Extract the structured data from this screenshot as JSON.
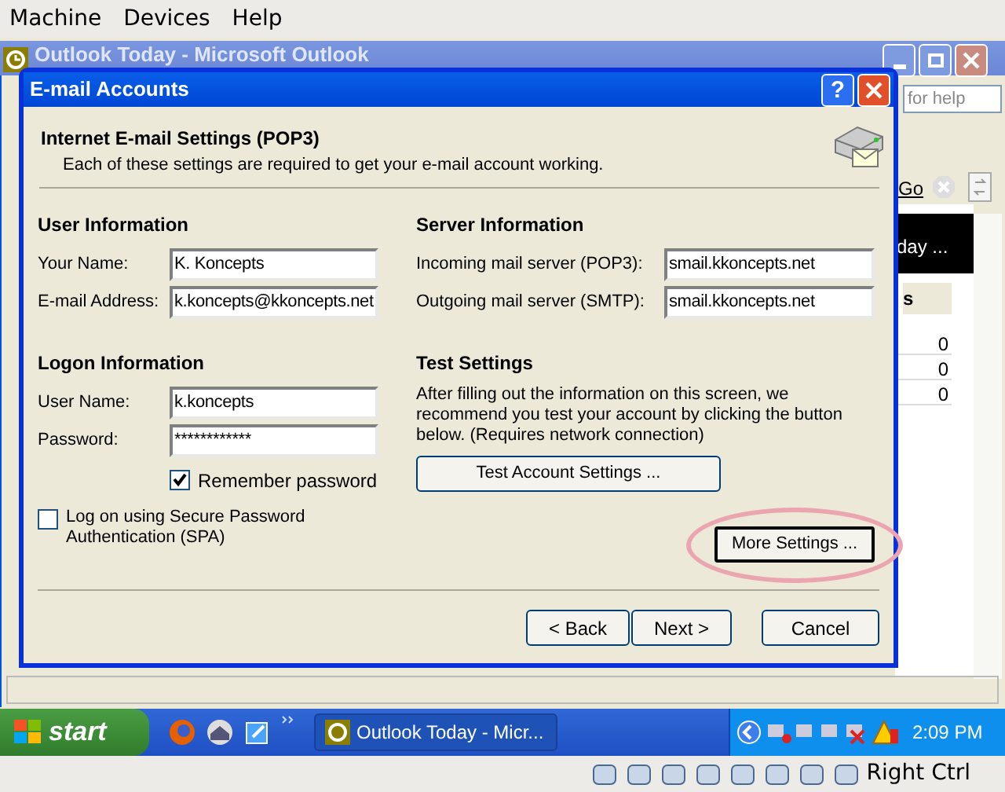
{
  "vbox_menu": [
    {
      "label": "Machine"
    },
    {
      "label": "Devices"
    },
    {
      "label": "Help"
    }
  ],
  "outlook": {
    "title": "Outlook Today - Microsoft Outlook",
    "help_box": "for help",
    "go": "Go",
    "panel_heading": "day ...",
    "column_header": "s",
    "counts": [
      "0",
      "0",
      "0"
    ]
  },
  "dialog": {
    "title": "E-mail Accounts",
    "help_glyph": "?",
    "heading": "Internet E-mail Settings (POP3)",
    "subheading": "Each of these settings are required to get your e-mail account working.",
    "left_sections": [
      {
        "title": "User Information",
        "fields": [
          {
            "label": "Your Name:",
            "value": "K. Koncepts"
          },
          {
            "label": "E-mail Address:",
            "value": "k.koncepts@kkoncepts.net"
          }
        ]
      },
      {
        "title": "Logon Information",
        "fields": [
          {
            "label": "User Name:",
            "value": "k.koncepts"
          },
          {
            "label": "Password:",
            "value": "************"
          }
        ]
      }
    ],
    "server_section": {
      "title": "Server Information",
      "fields": [
        {
          "label": "Incoming mail server (POP3):",
          "value": "smail.kkoncepts.net"
        },
        {
          "label": "Outgoing mail server (SMTP):",
          "value": "smail.kkoncepts.net"
        }
      ]
    },
    "remember_password": {
      "label": "Remember password",
      "checked": true
    },
    "spa": {
      "label": "Log on using Secure Password Authentication (SPA)",
      "checked": false
    },
    "test_title": "Test Settings",
    "test_text": "After filling out the information on this screen, we recommend you test your account by clicking the button below. (Requires network connection)",
    "test_button": "Test Account Settings ...",
    "more_button": {
      "label": "More Settings ...",
      "circled": true
    },
    "nav_buttons": [
      "< Back",
      "Next >",
      "Cancel"
    ]
  },
  "taskbar": {
    "start": "start",
    "task": "Outlook Today - Micr...",
    "clock": "2:09 PM"
  },
  "status_bar": {
    "host_key": "Right Ctrl"
  }
}
